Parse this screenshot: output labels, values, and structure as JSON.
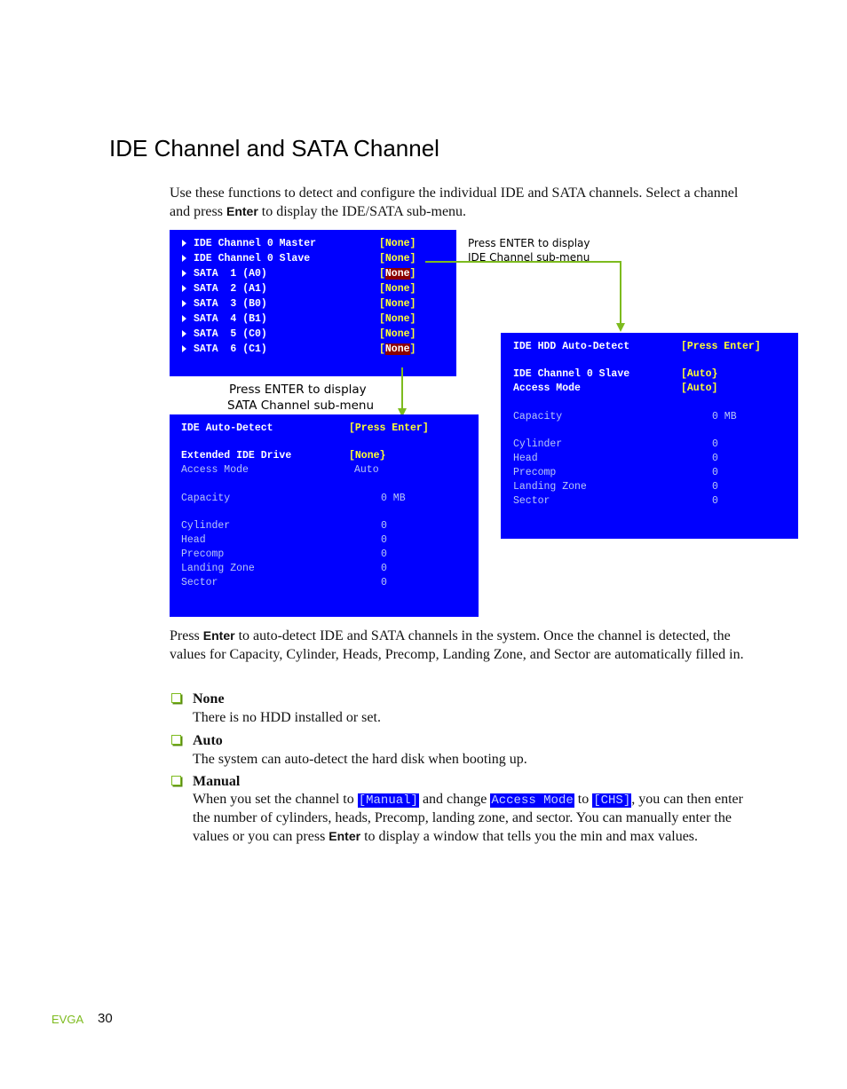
{
  "page": {
    "title": "IDE Channel and SATA Channel",
    "intro": {
      "before": "Use these functions to detect and configure the individual IDE and SATA channels. Select a channel and press ",
      "key": "Enter",
      "after": " to display the IDE/SATA sub-menu."
    },
    "footer": {
      "brand": "EVGA",
      "page_number": "30"
    }
  },
  "colors": {
    "bios_bg": "#0000ff",
    "value_yellow": "#ffff33",
    "selected_bg": "#8b0000",
    "accent_green": "#7dbb1e"
  },
  "main_menu": {
    "items": [
      {
        "label": "IDE Channel 0 Master",
        "value": "None",
        "selected": false
      },
      {
        "label": "IDE Channel 0 Slave",
        "value": "None",
        "selected": false
      },
      {
        "label": "SATA  1 (A0)",
        "value": "None",
        "selected": true
      },
      {
        "label": "SATA  2 (A1)",
        "value": "None",
        "selected": false
      },
      {
        "label": "SATA  3 (B0)",
        "value": "None",
        "selected": false
      },
      {
        "label": "SATA  4 (B1)",
        "value": "None",
        "selected": false
      },
      {
        "label": "SATA  5 (C0)",
        "value": "None",
        "selected": false
      },
      {
        "label": "SATA  6 (C1)",
        "value": "None",
        "selected": true
      }
    ]
  },
  "callouts": {
    "ide": [
      "Press ENTER to display",
      "IDE Channel sub-menu"
    ],
    "sata": [
      "Press ENTER to display",
      "SATA Channel sub-menu"
    ]
  },
  "sata_submenu": {
    "detect_label": "IDE Auto-Detect",
    "detect_value": "[Press Enter]",
    "drive_label": "Extended IDE Drive",
    "drive_value": "[None}",
    "access_label": "Access Mode",
    "access_value": "Auto",
    "capacity_label": "Capacity",
    "capacity_value": "0 MB",
    "fields": [
      {
        "label": "Cylinder",
        "value": "0"
      },
      {
        "label": "Head",
        "value": "0"
      },
      {
        "label": "Precomp",
        "value": "0"
      },
      {
        "label": "Landing Zone",
        "value": "0"
      },
      {
        "label": "Sector",
        "value": "0"
      }
    ]
  },
  "ide_submenu": {
    "detect_label": "IDE HDD Auto-Detect",
    "detect_value": "[Press Enter]",
    "channel_label": "IDE Channel 0 Slave",
    "channel_value": "[Auto}",
    "access_label": "Access Mode",
    "access_value": "[Auto]",
    "capacity_label": "Capacity",
    "capacity_value": "0 MB",
    "fields": [
      {
        "label": "Cylinder",
        "value": "0"
      },
      {
        "label": "Head",
        "value": "0"
      },
      {
        "label": "Precomp",
        "value": "0"
      },
      {
        "label": "Landing Zone",
        "value": "0"
      },
      {
        "label": "Sector",
        "value": "0"
      }
    ]
  },
  "body": {
    "press": {
      "before": "Press ",
      "key": "Enter",
      "after": " to auto-detect IDE and SATA channels in the system. Once the channel is detected, the values for Capacity, Cylinder, Heads, Precomp, Landing Zone, and Sector are automatically filled in."
    },
    "options": [
      {
        "title": "None",
        "text": "There is no HDD installed or set."
      },
      {
        "title": "Auto",
        "text": "The system can auto-detect the hard disk when booting up."
      },
      {
        "title": "Manual",
        "t1": "When you set the channel to ",
        "c1": "[Manual]",
        "t2": " and change ",
        "c2": "Access Mode",
        "t3": " to ",
        "c3": "[CHS]",
        "t4": ", you can then enter the number of cylinders, heads, Precomp, landing zone, and sector. You can manually enter the values or you can press ",
        "key": "Enter",
        "t5": " to display a window that tells you the min and max values."
      }
    ]
  }
}
